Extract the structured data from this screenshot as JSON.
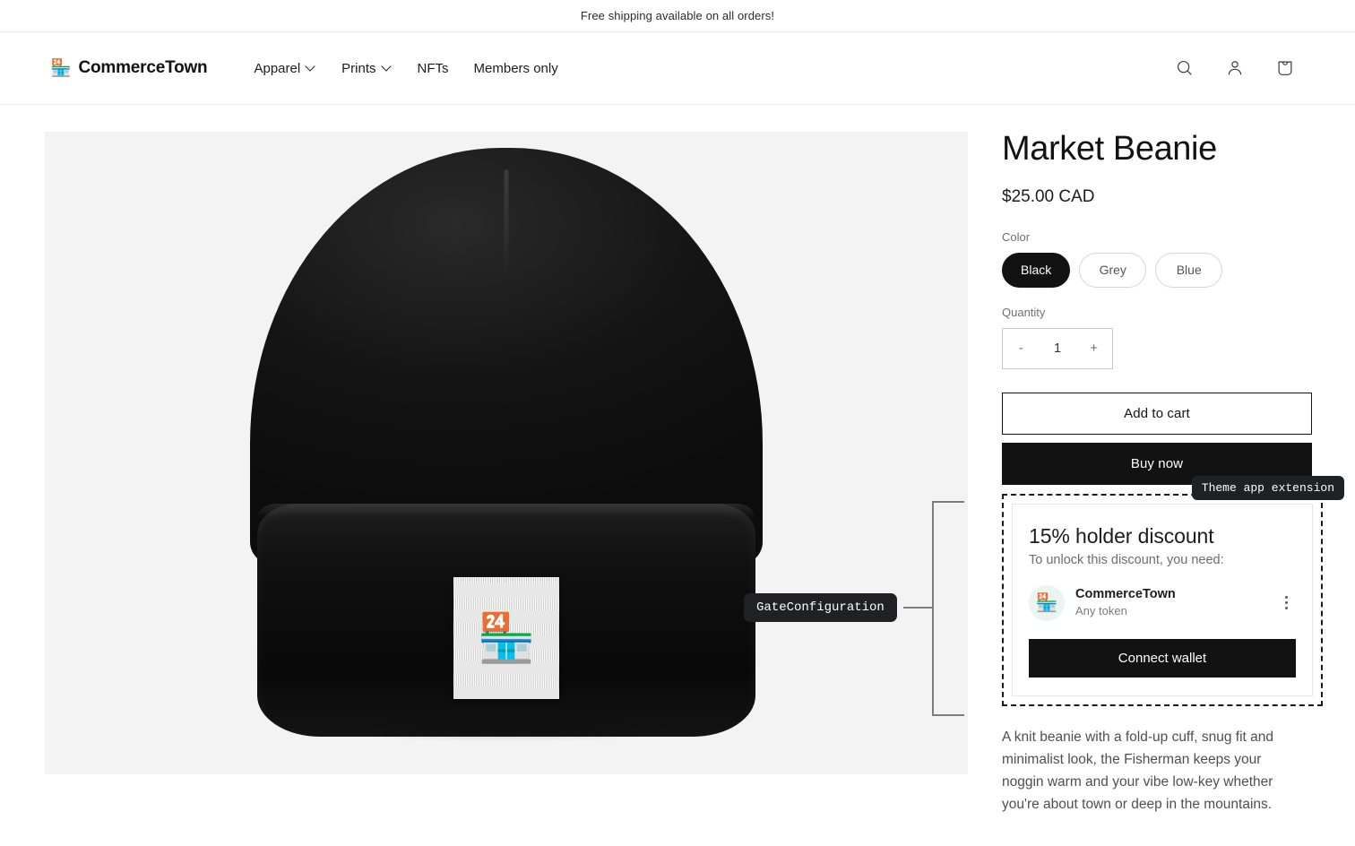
{
  "announcement": {
    "text": "Free shipping available on all orders!"
  },
  "header": {
    "brand": {
      "emoji": "🏪",
      "name": "CommerceTown"
    },
    "nav": [
      {
        "label": "Apparel",
        "has_dropdown": true
      },
      {
        "label": "Prints",
        "has_dropdown": true
      },
      {
        "label": "NFTs",
        "has_dropdown": false
      },
      {
        "label": "Members only",
        "has_dropdown": false
      }
    ],
    "actions": [
      {
        "name": "search-icon",
        "label": "Search"
      },
      {
        "name": "account-icon",
        "label": "Log in"
      },
      {
        "name": "cart-icon",
        "label": "Cart"
      }
    ]
  },
  "gallery": {
    "alt": "Black knit beanie with embroidered storefront patch",
    "patch_emoji": "🏪",
    "background_color": "#f3f3f3"
  },
  "product": {
    "title": "Market Beanie",
    "price": "$25.00 CAD",
    "color_label": "Color",
    "colors": [
      {
        "label": "Black",
        "selected": true
      },
      {
        "label": "Grey",
        "selected": false
      },
      {
        "label": "Blue",
        "selected": false
      }
    ],
    "quantity_label": "Quantity",
    "quantity_decrease": "-",
    "quantity_value": "1",
    "quantity_increase": "+",
    "add_to_cart_label": "Add to cart",
    "buy_now_label": "Buy now",
    "description": "A knit beanie with a fold-up cuff, snug fit and minimalist look, the Fisherman keeps your noggin warm and your vibe low-key whether you're about town or deep in the mountains."
  },
  "extension": {
    "badge": "Theme app extension",
    "callout": "GateConfiguration",
    "title": "15% holder discount",
    "subtitle": "To unlock this discount, you need:",
    "token": {
      "emoji": "🏪",
      "name": "CommerceTown",
      "description": "Any token",
      "avatar_bg": "#e9f5ee"
    },
    "connect_label": "Connect wallet"
  },
  "colors": {
    "accent": "#121212",
    "page_bg": "#ffffff",
    "media_bg": "#f3f3f3",
    "badge_bg": "#1f2124",
    "bracket": "#7d7d7d"
  }
}
